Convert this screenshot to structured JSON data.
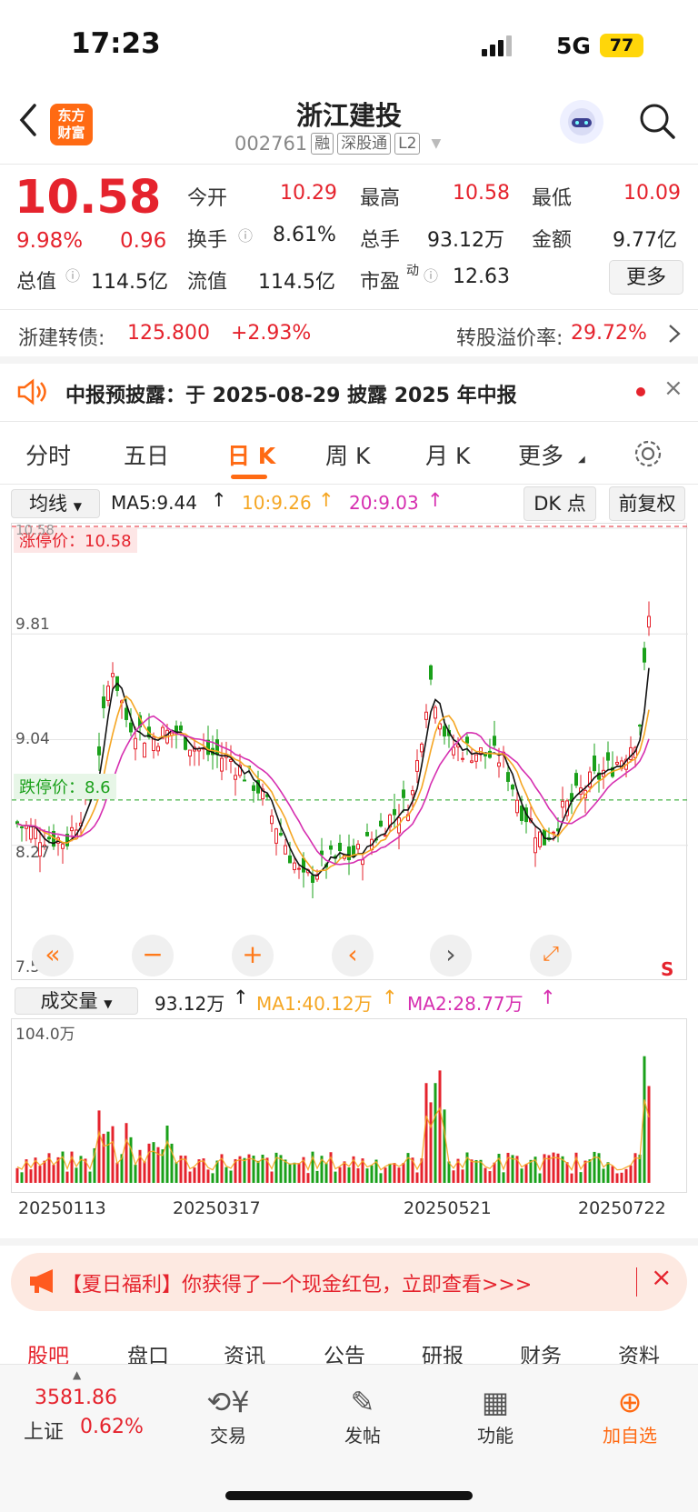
{
  "status": {
    "time": "17:23",
    "network": "5G",
    "battery": "77"
  },
  "header": {
    "title": "浙江建投",
    "code": "002761",
    "tags": [
      "融",
      "深股通",
      "L2"
    ],
    "logo_line1": "东方",
    "logo_line2": "财富"
  },
  "quote": {
    "price": "10.58",
    "change_pct": "9.98%",
    "change": "0.96",
    "items": [
      {
        "label": "今开",
        "value": "10.29"
      },
      {
        "label": "最高",
        "value": "10.58"
      },
      {
        "label": "最低",
        "value": "10.09"
      },
      {
        "label": "换手",
        "value": "8.61%"
      },
      {
        "label": "总手",
        "value": "93.12万"
      },
      {
        "label": "金额",
        "value": "9.77亿"
      },
      {
        "label": "总值",
        "value": "114.5亿"
      },
      {
        "label": "流值",
        "value": "114.5亿"
      },
      {
        "label": "市盈",
        "value": "12.63"
      }
    ],
    "pe_sup": "动",
    "more": "更多"
  },
  "bond": {
    "label": "浙建转债:",
    "price": "125.800",
    "change": "+2.93%",
    "premium_label": "转股溢价率:",
    "premium": "29.72%"
  },
  "notice": "中报预披露：于 2025-08-29 披露 2025 年中报",
  "tabs": [
    "分时",
    "五日",
    "日 K",
    "周 K",
    "月 K",
    "更多"
  ],
  "ma": {
    "selector": "均线",
    "ma5": "MA5:9.44",
    "ma10": "10:9.26",
    "ma20": "20:9.03",
    "dk": "DK 点",
    "fq": "前复权"
  },
  "chart_data": {
    "type": "candlestick",
    "limit_up_label": "涨停价：10.58",
    "limit_down_label": "跌停价：8.6",
    "y_ticks": [
      "10.58",
      "9.81",
      "9.04",
      "8.27",
      "7.50"
    ],
    "ylim": [
      7.5,
      10.58
    ],
    "colors": {
      "up": "#e5232d",
      "down": "#1aa01a",
      "ma5": "#111111",
      "ma10": "#f5a623",
      "ma20": "#d62fb0"
    }
  },
  "volume": {
    "selector": "成交量",
    "value": "93.12万",
    "ma1": "MA1:40.12万",
    "ma2": "MA2:28.77万",
    "ymax_label": "104.0万"
  },
  "dates": [
    "20250113",
    "20250317",
    "20250521",
    "20250722"
  ],
  "banner": "【夏日福利】你获得了一个现金红包，立即查看>>>",
  "bottom_tabs": [
    "股吧",
    "盘口",
    "资讯",
    "公告",
    "研报",
    "财务",
    "资料"
  ],
  "index": {
    "value": "3581.86",
    "name": "上证",
    "change": "0.62%"
  },
  "bottom_nav": [
    "交易",
    "发帖",
    "功能",
    "加自选"
  ]
}
